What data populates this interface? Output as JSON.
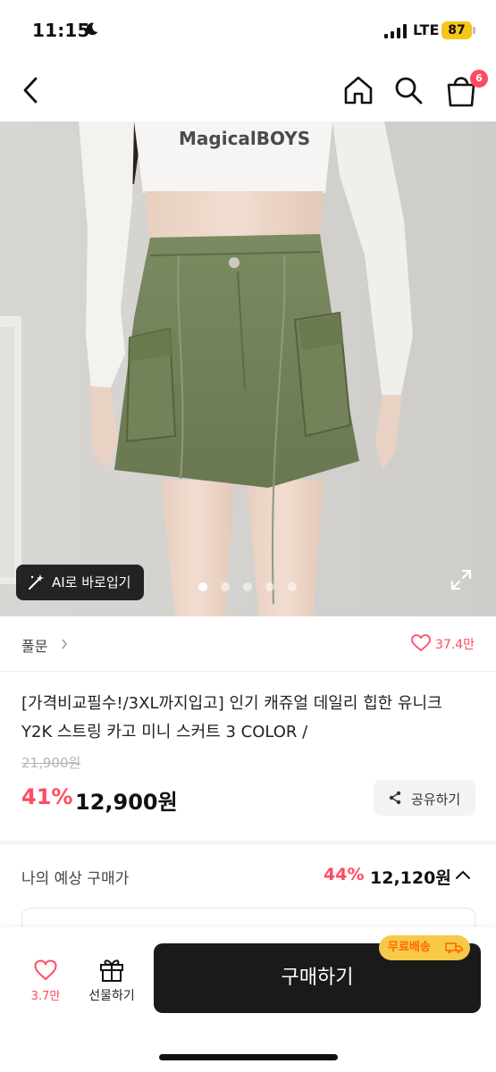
{
  "status_bar": {
    "time": "11:15",
    "network": "LTE",
    "battery": "87",
    "battery_color": "#f5c518"
  },
  "nav": {
    "cart_count": "6",
    "icons": [
      "back-icon",
      "home-icon",
      "search-icon",
      "shopping-bag-icon"
    ]
  },
  "hero": {
    "image_text": "MagicalBOYS",
    "ai_label": "AI로 바로입기",
    "slide_count": 5,
    "active_slide": 1
  },
  "seller": {
    "name": "풀문",
    "likes": "37.4만"
  },
  "product": {
    "title": "[가격비교필수!/3XL까지입고] 인기 캐쥬얼 데일리 힙한 유니크 Y2K 스트링 카고 미니 스커트 3 COLOR /",
    "original_price": "21,900원",
    "discount_rate": "41%",
    "sale_price": "12,900원",
    "share_label": "공유하기"
  },
  "expected": {
    "label": "나의 예상 구매가",
    "rate": "44%",
    "price": "12,120원"
  },
  "bottom_bar": {
    "wish_count": "3.7만",
    "gift_label": "선물하기",
    "buy_label": "구매하기",
    "free_shipping": "무료배송"
  },
  "colors": {
    "accent": "#ff4b61",
    "primary_button": "#1a1a1a",
    "badge_yellow": "#f7c948",
    "badge_text": "#ff6a00"
  }
}
